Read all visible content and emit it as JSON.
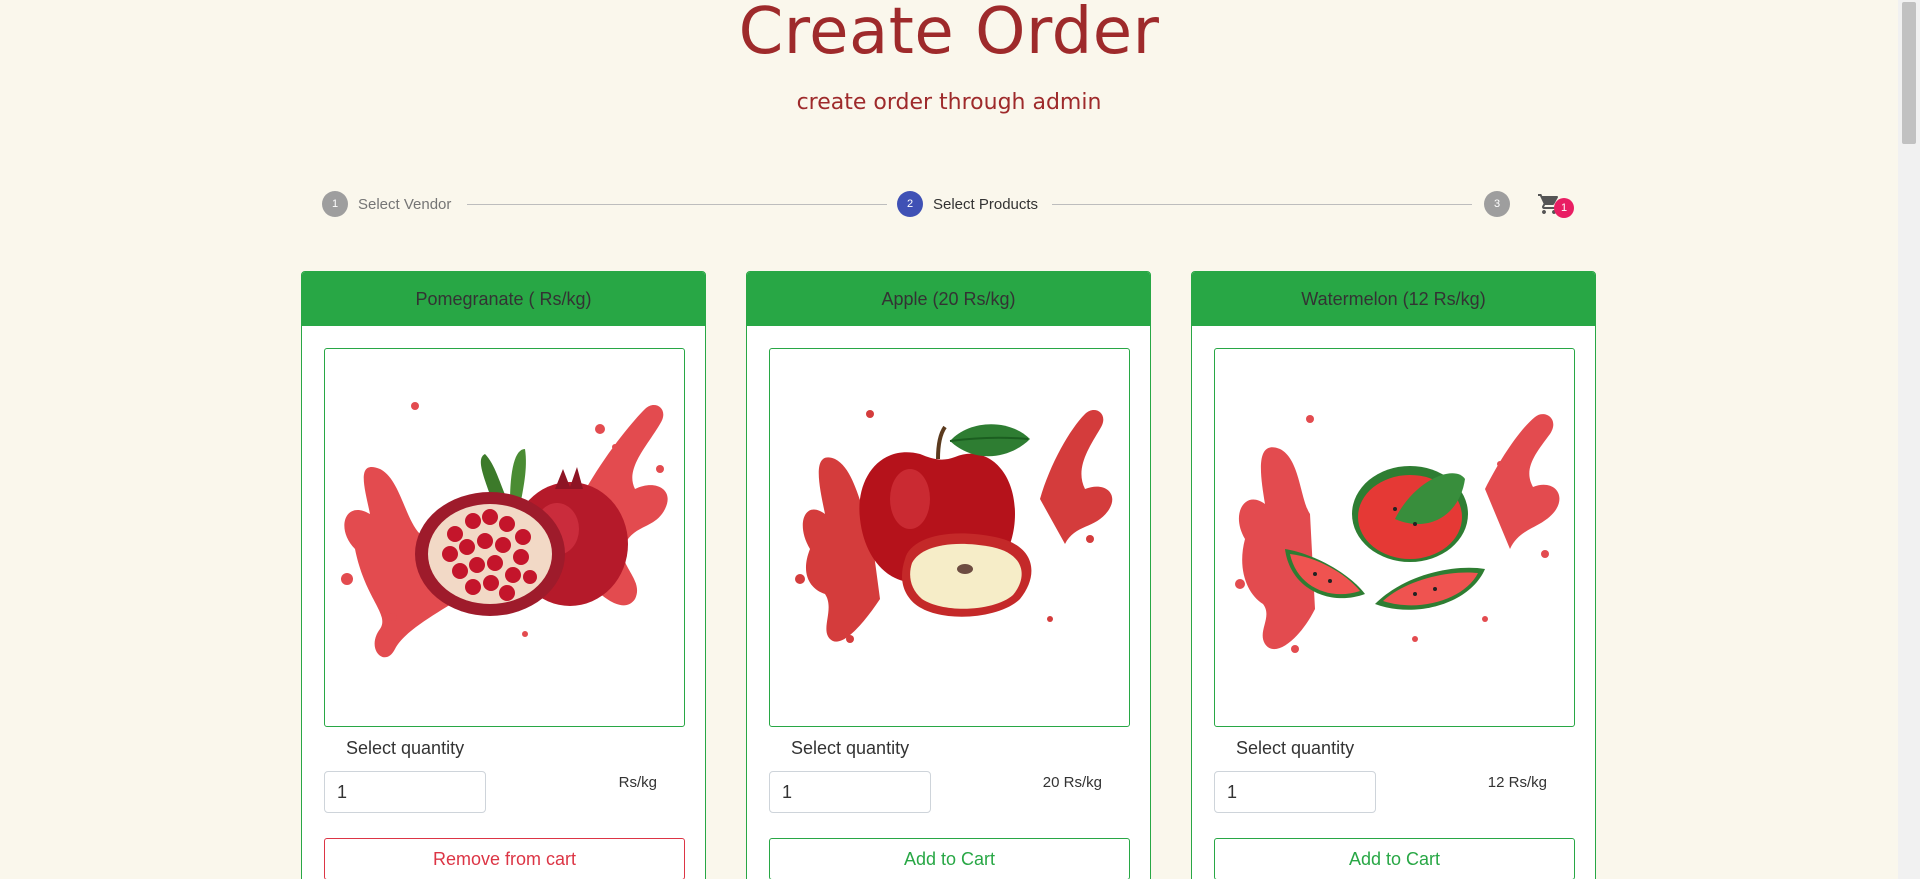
{
  "header": {
    "title": "Create Order",
    "subtitle": "create order through admin"
  },
  "stepper": {
    "steps": [
      {
        "number": "1",
        "label": "Select Vendor",
        "active": false
      },
      {
        "number": "2",
        "label": "Select Products",
        "active": true
      },
      {
        "number": "3",
        "label": "",
        "active": false
      }
    ],
    "cart_count": "1"
  },
  "products": [
    {
      "title": "Pomegranate ( Rs/kg)",
      "image_icon": "pomegranate-image",
      "qty_label": "Select quantity",
      "qty_value": "1",
      "price": "Rs/kg",
      "button_label": "Remove from cart",
      "in_cart": true
    },
    {
      "title": "Apple (20 Rs/kg)",
      "image_icon": "apple-image",
      "qty_label": "Select quantity",
      "qty_value": "1",
      "price": "20 Rs/kg",
      "button_label": "Add to Cart",
      "in_cart": false
    },
    {
      "title": "Watermelon (12 Rs/kg)",
      "image_icon": "watermelon-image",
      "qty_label": "Select quantity",
      "qty_value": "1",
      "price": "12 Rs/kg",
      "button_label": "Add to Cart",
      "in_cart": false
    }
  ],
  "colors": {
    "background": "#faf7ec",
    "title": "#9e2a2b",
    "card_header": "#28a745",
    "step_active": "#3f51b5",
    "badge": "#e91e63",
    "remove": "#dc3545"
  }
}
